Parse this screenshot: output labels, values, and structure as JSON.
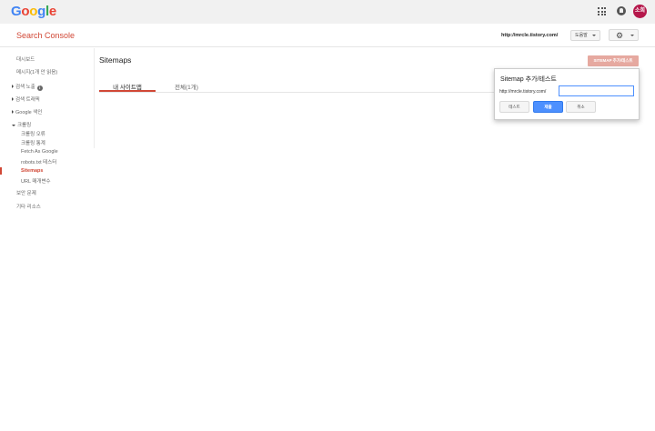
{
  "topbar": {
    "logo_letters": [
      {
        "ch": "G",
        "color": "#4285f4"
      },
      {
        "ch": "o",
        "color": "#ea4335"
      },
      {
        "ch": "o",
        "color": "#fbbc05"
      },
      {
        "ch": "g",
        "color": "#4285f4"
      },
      {
        "ch": "l",
        "color": "#34a853"
      },
      {
        "ch": "e",
        "color": "#ea4335"
      }
    ],
    "apps_icon": "apps-grid-icon",
    "notifications_icon": "bell-icon",
    "avatar_text": "소희",
    "avatar_color": "#b5174b"
  },
  "header": {
    "brand": "Search Console",
    "brand_color": "#d14836",
    "site_url": "http://mrcle.tistory.com/",
    "help_label": "도움말",
    "settings_icon": "gear-icon"
  },
  "sidebar": {
    "items": [
      {
        "label": "대시보드"
      },
      {
        "label": "메시지(1개 안 읽음)"
      },
      {
        "label": "검색 노출"
      },
      {
        "label": "검색 트래픽"
      },
      {
        "label": "Google 색인"
      },
      {
        "label": "크롤링"
      },
      {
        "label": "크롤링 오류"
      },
      {
        "label": "크롤링 통계"
      },
      {
        "label": "Fetch As Google"
      },
      {
        "label": "robots.txt 테스터"
      },
      {
        "label": "Sitemaps"
      },
      {
        "label": "URL 매개변수"
      },
      {
        "label": "보안 문제"
      },
      {
        "label": "기타 리소스"
      }
    ]
  },
  "main": {
    "title": "Sitemaps",
    "tabs": [
      {
        "label": "내 사이트맵"
      },
      {
        "label": "전체(1개)"
      }
    ],
    "add_button": "SITEMAP 추가/테스트"
  },
  "popup": {
    "title": "Sitemap 추가/테스트",
    "prefix": "http://mrcle.tistory.com/",
    "input_value": "",
    "buttons": {
      "test": "테스트",
      "submit": "제출",
      "cancel": "취소"
    }
  }
}
